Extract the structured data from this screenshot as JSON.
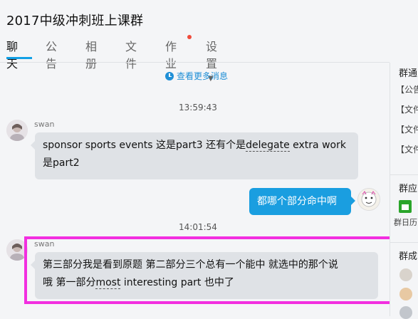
{
  "header": {
    "title": "2017中级冲刺班上课群",
    "tabs": [
      {
        "label": "聊天",
        "active": true
      },
      {
        "label": "公告"
      },
      {
        "label": "相册"
      },
      {
        "label": "文件"
      },
      {
        "label": "作业",
        "has_dot": true
      },
      {
        "label": "设置",
        "has_dropdown": true
      }
    ]
  },
  "chat": {
    "more_link": "查看更多消息",
    "messages": [
      {
        "time": "13:59:43",
        "sender": "swan",
        "text_parts": [
          "sponsor sports events 这是part3 还有个是",
          "delegate",
          " extra work",
          "是part2"
        ]
      },
      {
        "from_self": true,
        "text": "都哪个部分命中啊"
      },
      {
        "time": "14:01:54",
        "sender": "swan",
        "text_parts": [
          "第三部分我是看到原题 第二部分三个总有一个能中 就选中的那个说",
          "哦 第一部分",
          "most",
          " interesting part 也中了"
        ]
      }
    ]
  },
  "right_panel": {
    "section1": {
      "title": "群通",
      "items": [
        "【公告",
        "【文件",
        "【文件",
        "【文件"
      ]
    },
    "section2": {
      "title": "群应",
      "calendar_label": "群日历"
    },
    "section3": {
      "title": "群成"
    }
  },
  "colors": {
    "accent": "#12a0e6",
    "highlight": "#f22fe0",
    "self_bubble": "#1a9ee0",
    "other_bubble": "#dfe2e6"
  }
}
